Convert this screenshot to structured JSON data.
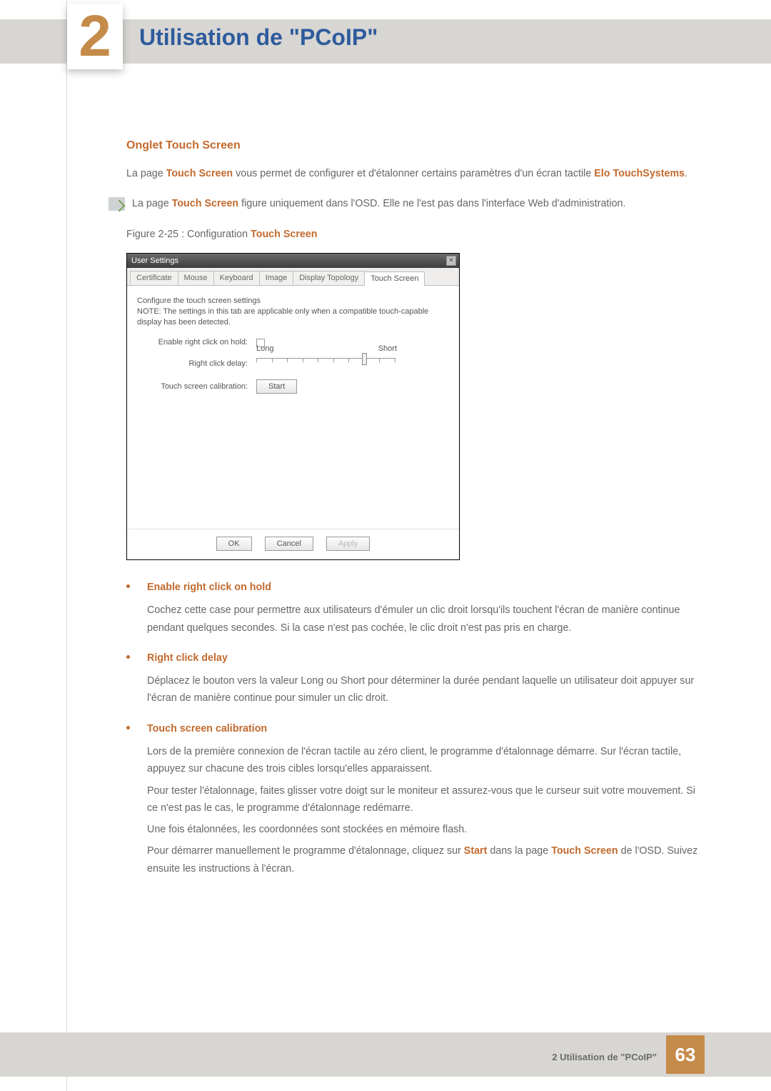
{
  "chapter": {
    "number": "2",
    "title": "Utilisation de \"PCoIP\""
  },
  "section": {
    "title": "Onglet Touch Screen"
  },
  "intro": {
    "prefix": "La page ",
    "term1": "Touch Screen",
    "mid": " vous permet de configurer et d'étalonner certains paramètres d'un écran tactile ",
    "term2": "Elo TouchSystems",
    "suffix": "."
  },
  "note": {
    "prefix": "La page ",
    "term": "Touch Screen",
    "rest": " figure uniquement dans l'OSD. Elle ne l'est pas dans l'interface Web d'administration."
  },
  "figure": {
    "prefix": "Figure 2-25 : Configuration ",
    "term": "Touch Screen"
  },
  "dialog": {
    "title": "User Settings",
    "close": "×",
    "tabs": [
      "Certificate",
      "Mouse",
      "Keyboard",
      "Image",
      "Display Topology",
      "Touch Screen"
    ],
    "active_tab_index": 5,
    "config_heading": "Configure the touch screen settings",
    "config_note": "NOTE: The settings in this tab are applicable only when a compatible touch-capable display has been detected.",
    "rows": {
      "enable_label": "Enable right click on hold:",
      "delay_label": "Right click delay:",
      "calib_label": "Touch screen calibration:"
    },
    "slider": {
      "long": "Long",
      "short": "Short",
      "ticks": 10,
      "thumb_pct": 76
    },
    "start_button": "Start",
    "buttons": {
      "ok": "OK",
      "cancel": "Cancel",
      "apply": "Apply"
    }
  },
  "bullets": [
    {
      "title": "Enable right click on hold",
      "body": [
        "Cochez cette case pour permettre aux utilisateurs d'émuler un clic droit lorsqu'ils touchent l'écran de manière continue pendant quelques secondes. Si la case n'est pas cochée, le clic droit n'est pas pris en charge."
      ]
    },
    {
      "title": "Right click delay",
      "body": [
        "Déplacez le bouton vers la valeur Long ou Short pour déterminer la durée pendant laquelle un utilisateur doit appuyer sur l'écran de manière continue pour simuler un clic droit."
      ]
    },
    {
      "title": "Touch screen calibration",
      "body": [
        "Lors de la première connexion de l'écran tactile au zéro client, le programme d'étalonnage démarre. Sur l'écran tactile, appuyez sur chacune des trois cibles lorsqu'elles apparaissent.",
        "Pour tester l'étalonnage, faites glisser votre doigt sur le moniteur et assurez-vous que le curseur suit votre mouvement. Si ce n'est pas le cas, le programme d'étalonnage redémarre.",
        "Une fois étalonnées, les coordonnées sont stockées en mémoire flash."
      ],
      "tail": {
        "p1a": "Pour démarrer manuellement le programme d'étalonnage, cliquez sur ",
        "start": "Start",
        "p1b": " dans la page ",
        "ts": "Touch Screen",
        "p1c": " de l'OSD. Suivez ensuite les instructions à l'écran."
      }
    }
  ],
  "footer": {
    "label": "2 Utilisation de \"PCoIP\"",
    "page": "63"
  }
}
